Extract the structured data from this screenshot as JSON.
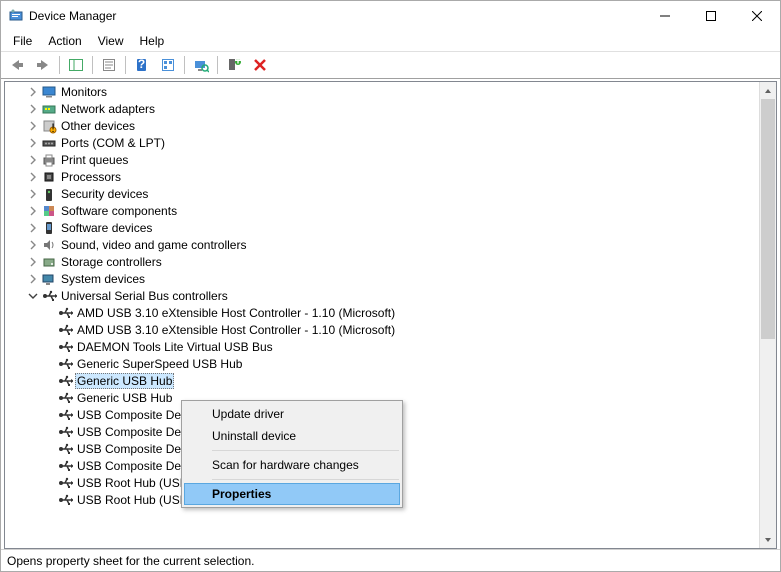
{
  "window": {
    "title": "Device Manager"
  },
  "menu": {
    "file": "File",
    "action": "Action",
    "view": "View",
    "help": "Help"
  },
  "tree": {
    "categories": [
      {
        "label": "Monitors",
        "icon": "monitor"
      },
      {
        "label": "Network adapters",
        "icon": "network"
      },
      {
        "label": "Other devices",
        "icon": "other"
      },
      {
        "label": "Ports (COM & LPT)",
        "icon": "port"
      },
      {
        "label": "Print queues",
        "icon": "printer"
      },
      {
        "label": "Processors",
        "icon": "cpu"
      },
      {
        "label": "Security devices",
        "icon": "security"
      },
      {
        "label": "Software components",
        "icon": "swcomp"
      },
      {
        "label": "Software devices",
        "icon": "swdev"
      },
      {
        "label": "Sound, video and game controllers",
        "icon": "sound"
      },
      {
        "label": "Storage controllers",
        "icon": "storage"
      },
      {
        "label": "System devices",
        "icon": "system"
      },
      {
        "label": "Universal Serial Bus controllers",
        "icon": "usb",
        "expanded": true
      }
    ],
    "usb_devices": [
      "AMD USB 3.10 eXtensible Host Controller - 1.10 (Microsoft)",
      "AMD USB 3.10 eXtensible Host Controller - 1.10 (Microsoft)",
      "DAEMON Tools Lite Virtual USB Bus",
      "Generic SuperSpeed USB Hub",
      "Generic USB Hub",
      "Generic USB Hub",
      "USB Composite Device",
      "USB Composite Device",
      "USB Composite Device",
      "USB Composite Device",
      "USB Root Hub (USB 3.0)",
      "USB Root Hub (USB 3.0)"
    ],
    "selected_index": 4
  },
  "context_menu": {
    "update": "Update driver",
    "uninstall": "Uninstall device",
    "scan": "Scan for hardware changes",
    "properties": "Properties"
  },
  "status": "Opens property sheet for the current selection."
}
